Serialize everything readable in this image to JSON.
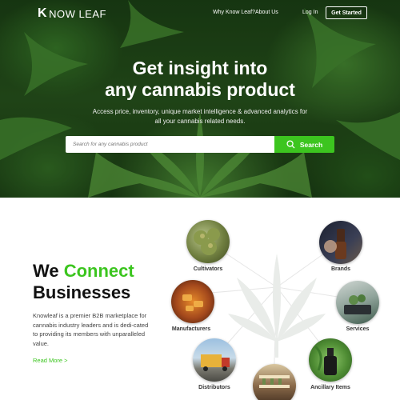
{
  "nav": {
    "logo_text": "NOW LEAF",
    "logo_mark": "K",
    "links": [
      "Why Know Leaf?",
      "About Us",
      "Log In"
    ],
    "cta": "Get Started"
  },
  "hero": {
    "title_line1": "Get insight into",
    "title_line2": "any cannabis product",
    "subtitle_line1": "Access price, inventory, unique market intelligence & advanced analytics for",
    "subtitle_line2": "all your cannabis related needs.",
    "search_placeholder": "Search for any cannabis product",
    "search_button": "Search"
  },
  "connect": {
    "headline_we": "We ",
    "headline_connect": "Connect",
    "headline_line2": "Businesses",
    "description": "Knowleaf is a premier B2B marketplace for cannabis industry leaders and is dedi-cated to providing its members with unparalleled value.",
    "read_more": "Read More >"
  },
  "categories": [
    {
      "label": "Cultivators",
      "icon": "cannabis-buds-photo"
    },
    {
      "label": "Brands",
      "icon": "dropper-bottle-photo"
    },
    {
      "label": "Manufacturers",
      "icon": "processing-photo"
    },
    {
      "label": "Services",
      "icon": "scale-service-photo"
    },
    {
      "label": "Distributors",
      "icon": "truck-photo"
    },
    {
      "label": "Ancillary Items",
      "icon": "tincture-bottle-photo"
    },
    {
      "label": "",
      "icon": "dispensary-shelf-photo"
    }
  ],
  "colors": {
    "accent": "#3cc51f",
    "hero_dark": "#1f4a18"
  }
}
